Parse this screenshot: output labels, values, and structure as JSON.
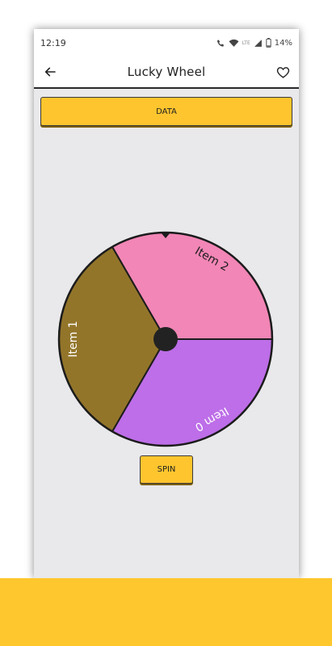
{
  "status_bar": {
    "time": "12:19",
    "network": "LTE",
    "battery": "14%"
  },
  "app_bar": {
    "title": "Lucky Wheel"
  },
  "buttons": {
    "data_label": "DATA",
    "spin_label": "SPIN"
  },
  "wheel": {
    "segments": [
      {
        "label": "Item 0",
        "color": "#bd6ee8"
      },
      {
        "label": "Item 1",
        "color": "#93752a"
      },
      {
        "label": "Item 2",
        "color": "#f286b6"
      }
    ],
    "hub_color": "#222222"
  },
  "colors": {
    "accent": "#ffc52e",
    "background": "#e9e8ea"
  }
}
